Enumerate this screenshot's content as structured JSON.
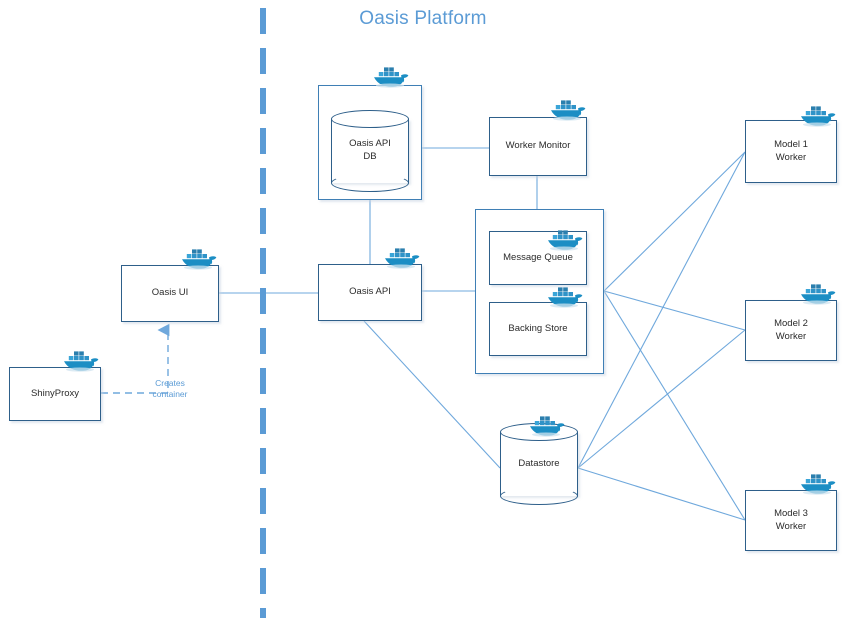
{
  "diagram": {
    "title": "Oasis Platform",
    "colors": {
      "title": "#5b9bd5",
      "node_border": "#2e5f8a",
      "group_border": "#3f7fb5",
      "connector": "#6fa8dc",
      "divider": "#5b9bd5",
      "docker_blue": "#2496ed",
      "label_text": "#2b2b2b"
    },
    "divider": {
      "name": "platform-boundary",
      "style": "dashed-vertical"
    },
    "nodes": [
      {
        "id": "shinyproxy",
        "label": "ShinyProxy",
        "shape": "rect",
        "docker": true
      },
      {
        "id": "oasis-ui",
        "label": "Oasis UI",
        "shape": "rect",
        "docker": true
      },
      {
        "id": "oasis-api",
        "label": "Oasis API",
        "shape": "rect",
        "docker": true
      },
      {
        "id": "oasis-api-db",
        "label": "Oasis API\nDB",
        "shape": "cylinder",
        "docker": true
      },
      {
        "id": "worker-monitor",
        "label": "Worker Monitor",
        "shape": "rect",
        "docker": true
      },
      {
        "id": "message-queue",
        "label": "Message Queue",
        "shape": "rect",
        "docker": true
      },
      {
        "id": "backing-store",
        "label": "Backing Store",
        "shape": "rect",
        "docker": true
      },
      {
        "id": "datastore",
        "label": "Datastore",
        "shape": "cylinder",
        "docker": true
      },
      {
        "id": "model-1-worker",
        "label": "Model 1\nWorker",
        "shape": "rect",
        "docker": true
      },
      {
        "id": "model-2-worker",
        "label": "Model 2\nWorker",
        "shape": "rect",
        "docker": true
      },
      {
        "id": "model-3-worker",
        "label": "Model 3\nWorker",
        "shape": "rect",
        "docker": true
      }
    ],
    "groups": [
      {
        "id": "broker-group",
        "label": "",
        "contains": [
          "message-queue",
          "backing-store"
        ]
      },
      {
        "id": "api-db-group",
        "label": "",
        "contains": [
          "oasis-api-db"
        ]
      }
    ],
    "edge_labels": [
      {
        "id": "creates-container",
        "text": "Creates\ncontainer"
      }
    ],
    "edges": [
      {
        "from": "shinyproxy",
        "to": "oasis-ui",
        "style": "dashed",
        "arrow": true,
        "label": "Creates container"
      },
      {
        "from": "oasis-ui",
        "to": "oasis-api",
        "style": "solid",
        "arrow": false
      },
      {
        "from": "oasis-api",
        "to": "oasis-api-db",
        "style": "solid",
        "arrow": false
      },
      {
        "from": "oasis-api-db",
        "to": "worker-monitor",
        "style": "solid",
        "arrow": false
      },
      {
        "from": "worker-monitor",
        "to": "broker-group",
        "style": "solid",
        "arrow": false
      },
      {
        "from": "oasis-api",
        "to": "broker-group",
        "style": "solid",
        "arrow": false
      },
      {
        "from": "oasis-api",
        "to": "datastore",
        "style": "solid",
        "arrow": false
      },
      {
        "from": "broker-group",
        "to": "model-1-worker",
        "style": "solid",
        "arrow": false
      },
      {
        "from": "broker-group",
        "to": "model-2-worker",
        "style": "solid",
        "arrow": false
      },
      {
        "from": "broker-group",
        "to": "model-3-worker",
        "style": "solid",
        "arrow": false
      },
      {
        "from": "datastore",
        "to": "model-1-worker",
        "style": "solid",
        "arrow": false
      },
      {
        "from": "datastore",
        "to": "model-2-worker",
        "style": "solid",
        "arrow": false
      },
      {
        "from": "datastore",
        "to": "model-3-worker",
        "style": "solid",
        "arrow": false
      }
    ],
    "icons": {
      "docker": "docker-whale-icon"
    }
  }
}
